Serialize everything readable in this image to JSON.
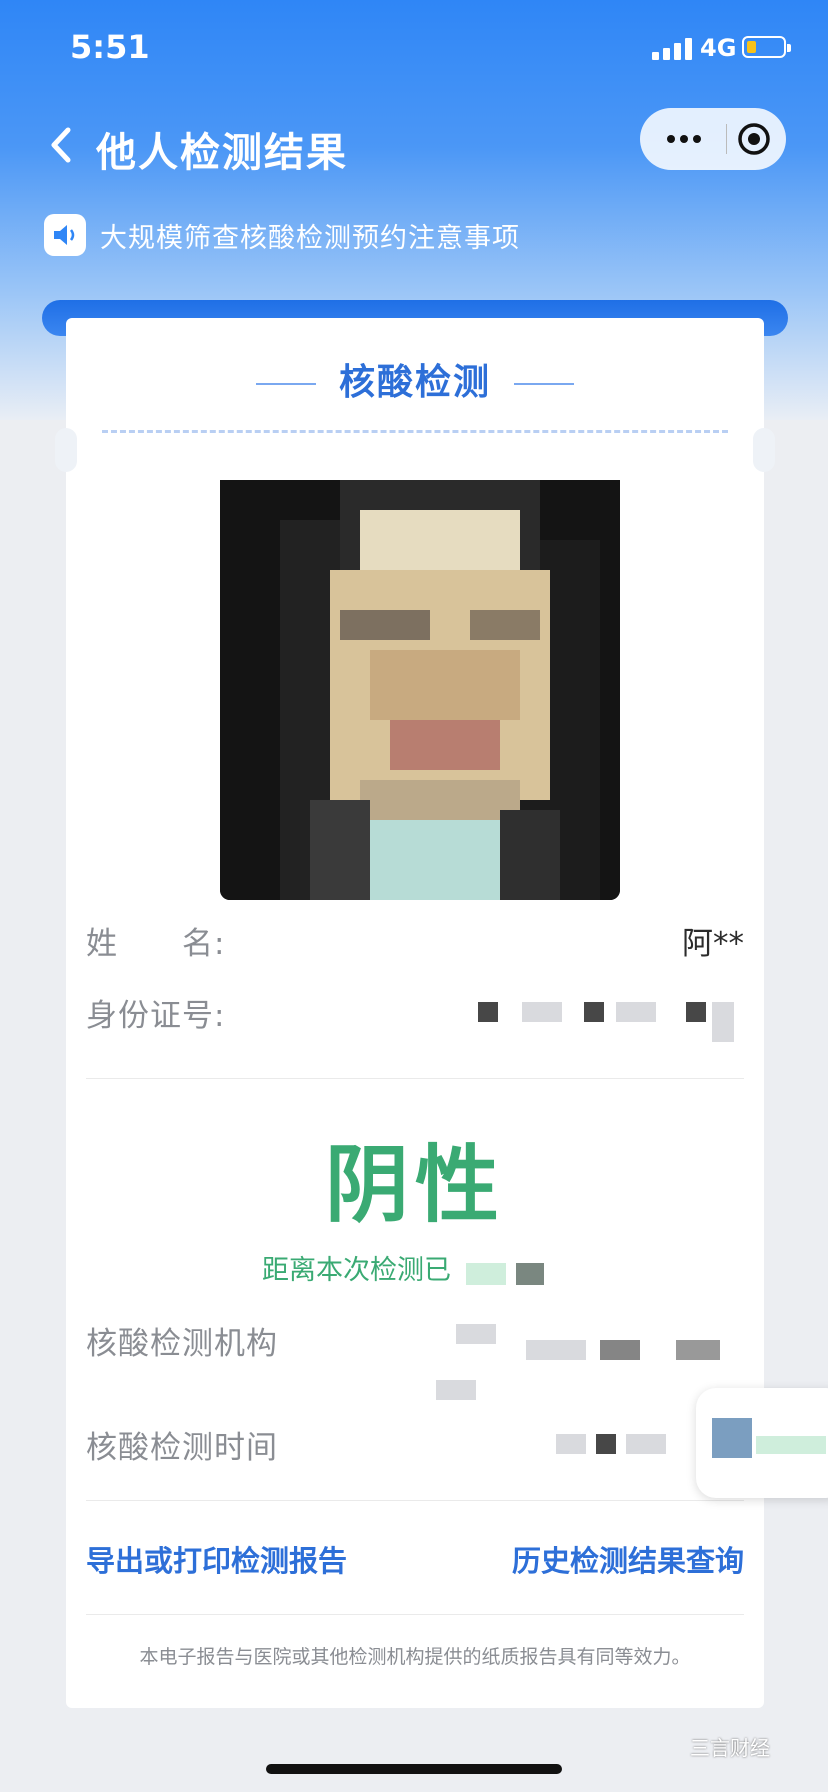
{
  "status_bar": {
    "time": "5:51",
    "network": "4G",
    "battery_color": "#f7c21a"
  },
  "nav": {
    "title": "他人检测结果"
  },
  "notice": {
    "text": "大规模筛查核酸检测预约注意事项"
  },
  "card": {
    "header_title": "核酸检测",
    "name_label": "姓　　名:",
    "name_value": "阿**",
    "id_label": "身份证号:",
    "result": "阴性",
    "result_color": "#3aaa73",
    "elapsed_text": "距离本次检测已",
    "institution_label": "核酸检测机构",
    "time_label": "核酸检测时间",
    "export_link": "导出或打印检测报告",
    "history_link": "历史检测结果查询",
    "footnote": "本电子报告与医院或其他检测机构提供的纸质报告具有同等效力。"
  },
  "colors": {
    "accent_blue": "#2d6fd8",
    "header_blue": "#2f86f6"
  },
  "icons": [
    "back-arrow-icon",
    "more-dots-icon",
    "target-icon",
    "speaker-icon"
  ],
  "watermark": "三言财经"
}
